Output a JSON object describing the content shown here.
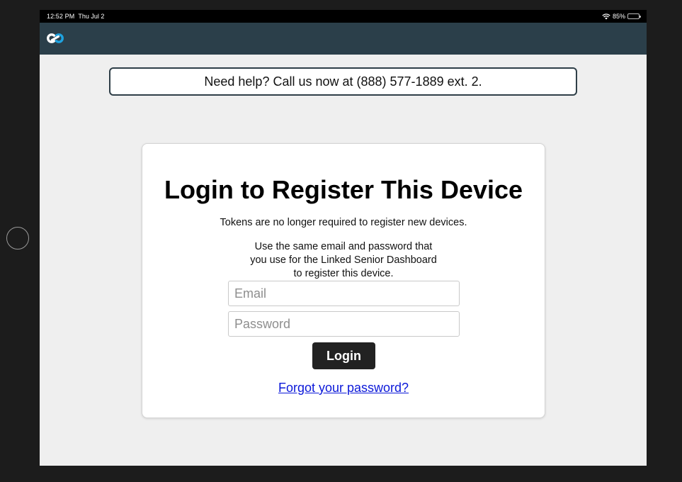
{
  "status_bar": {
    "time": "12:52 PM",
    "date": "Thu Jul 2",
    "battery_percent": "85%",
    "battery_level": 0.85,
    "icons": [
      "wifi-icon",
      "battery-icon"
    ]
  },
  "app_bar": {
    "logo_icon": "linked-senior-logo-icon",
    "background_color": "#2b3f4a"
  },
  "help_banner": {
    "text": "Need help? Call us now at (888) 577-1889 ext. 2."
  },
  "login_card": {
    "title": "Login to Register This Device",
    "line1": "Tokens are no longer required to register new devices.",
    "line2": "Use the same email and password that you use for the Linked Senior Dashboard to register this device.",
    "email_field": {
      "value": "",
      "placeholder": "Email"
    },
    "password_field": {
      "value": "",
      "placeholder": "Password"
    },
    "login_button": "Login",
    "forgot_link": "Forgot your password?"
  },
  "colors": {
    "accent": "#1fa3e0",
    "login_button": "#222222",
    "link": "#0b18d9",
    "banner_border": "#2f3f48"
  }
}
